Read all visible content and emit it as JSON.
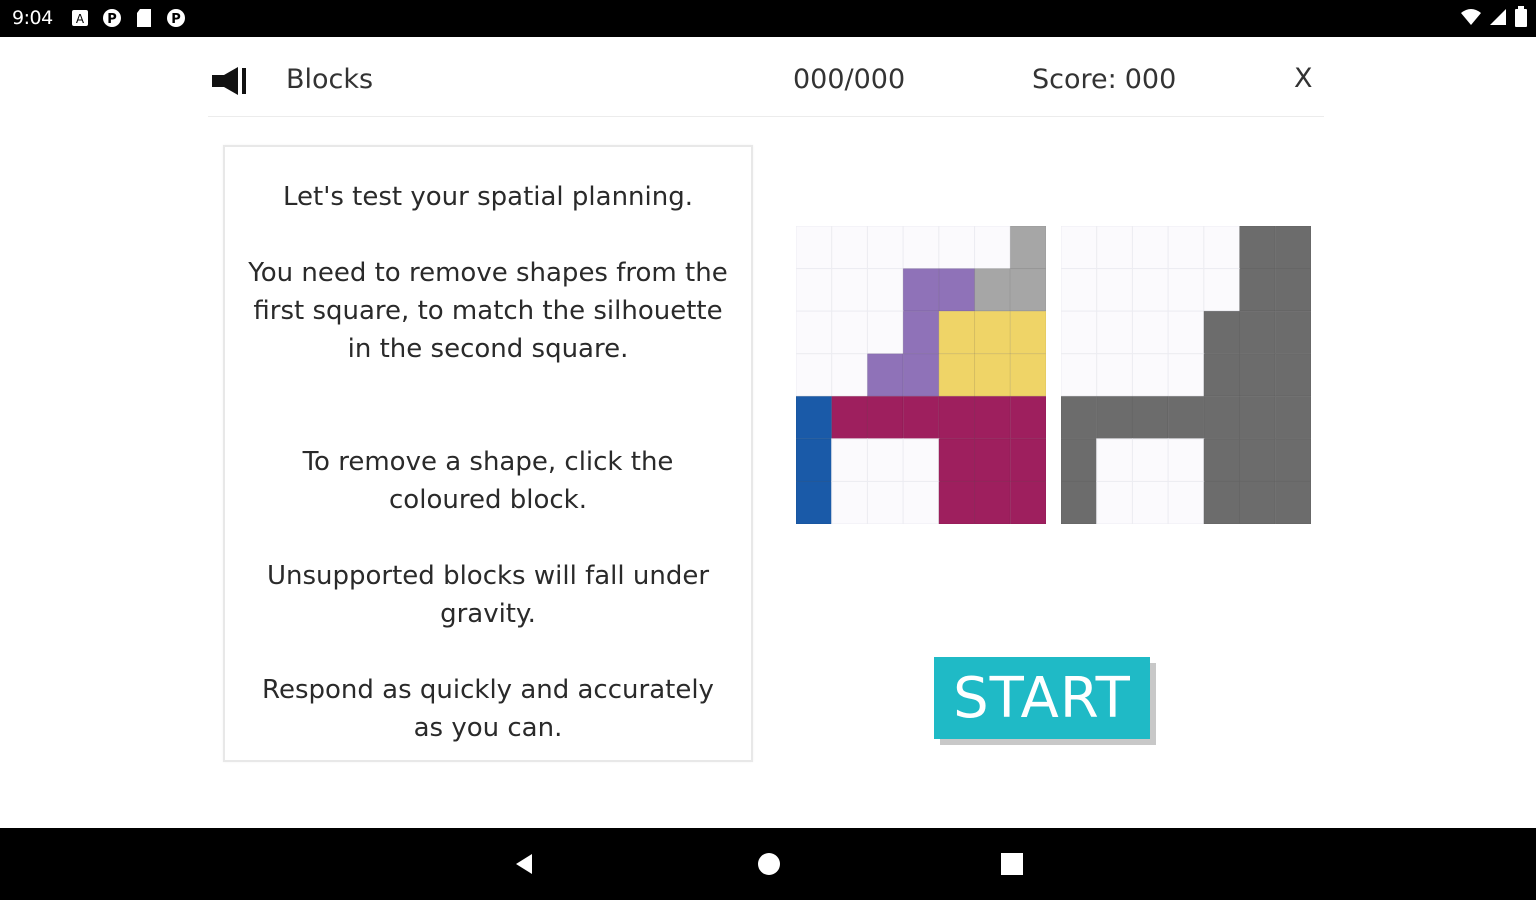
{
  "status_bar": {
    "time": "9:04",
    "left_icons": [
      "a-box-icon",
      "p-circle-icon",
      "sd-card-icon",
      "p-circle-icon"
    ],
    "right_icons": [
      "wifi-icon",
      "signal-icon",
      "battery-icon"
    ]
  },
  "header": {
    "sound_icon": "speaker-icon",
    "title": "Blocks",
    "progress": "000/000",
    "score_label": "Score:",
    "score_value": "000",
    "close_label": "X"
  },
  "instructions": {
    "paragraphs": [
      "Let's test your spatial planning.",
      "You need to remove shapes from the first square, to match the silhouette in the second square.",
      "To remove a shape, click the coloured block.",
      "Unsupported blocks will fall under gravity.",
      "Respond as quickly and accurately as you can."
    ]
  },
  "colors": {
    "grey_block": "#a6a6a6",
    "purple_block": "#8f72b8",
    "yellow_block": "#efd467",
    "blue_block": "#1a5aa8",
    "magenta_block": "#9e1f5e",
    "silhouette": "#6c6c6c",
    "grid_line": "#ececf2",
    "start_button": "#1fbac6"
  },
  "grids": {
    "rows": 7,
    "cols": 7,
    "source_cells": [
      "......G",
      "...PPGG",
      "...PYYY",
      "..PPYYY",
      "BMMMMMM",
      "B...MMM",
      "B...MMM"
    ],
    "target_cells": [
      ".....SS",
      ".....SS",
      "....SSS",
      "....SSS",
      "SSSSSSS",
      "S...SSS",
      "S...SSS"
    ]
  },
  "start_button": {
    "label": "START"
  },
  "nav_bar": {
    "icons": [
      "back-icon",
      "home-icon",
      "recent-apps-icon"
    ]
  }
}
